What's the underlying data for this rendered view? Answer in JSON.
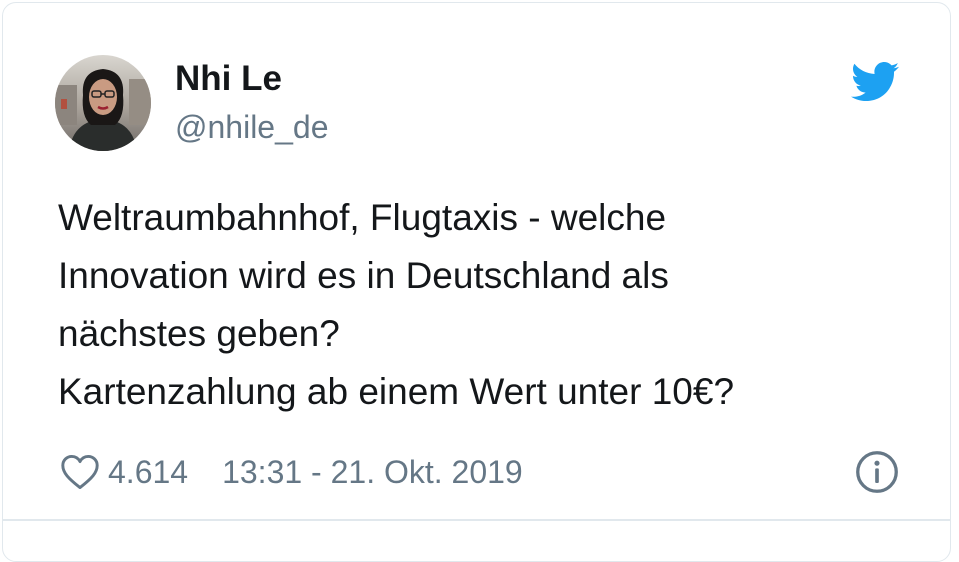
{
  "user": {
    "display_name": "Nhi Le",
    "handle": "@nhile_de",
    "avatar_icon": "profile-photo"
  },
  "brand": {
    "logo_icon": "twitter-bird-icon",
    "color": "#1da1f2"
  },
  "tweet": {
    "lines": [
      "Weltraumbahnhof, Flugtaxis - welche",
      "Innovation wird es in Deutschland als",
      "nächstes geben?",
      "Kartenzahlung ab einem Wert unter 10€?"
    ]
  },
  "footer": {
    "like_icon": "heart-icon",
    "like_count": "4.614",
    "timestamp": "13:31 - 21. Okt. 2019",
    "info_icon": "info-icon"
  }
}
